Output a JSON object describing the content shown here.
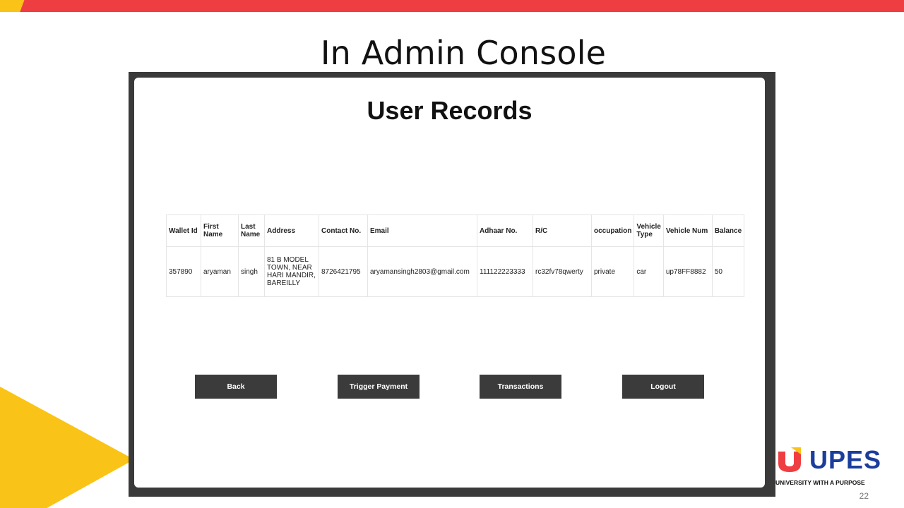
{
  "slide": {
    "title": "In Admin Console",
    "page_number": "22",
    "brand": {
      "name": "UPES",
      "tagline": "UNIVERSITY WITH A PURPOSE"
    }
  },
  "colors": {
    "accent_red": "#ef3e42",
    "accent_yellow": "#f9c417",
    "brand_blue": "#1b3d9c",
    "button": "#3b3b3b"
  },
  "app": {
    "heading": "User Records",
    "table": {
      "headers": [
        "Wallet Id",
        "First Name",
        "Last Name",
        "Address",
        "Contact No.",
        "Email",
        "Adhaar No.",
        "R/C",
        "occupation",
        "Vehicle Type",
        "Vehicle Num",
        "Balance"
      ],
      "rows": [
        {
          "wallet_id": "357890",
          "first_name": "aryaman",
          "last_name": "singh",
          "address": "81 B MODEL TOWN, NEAR HARI MANDIR, BAREILLY",
          "contact": "8726421795",
          "email": "aryamansingh2803@gmail.com",
          "adhaar": "111122223333",
          "rc": "rc32fv78qwerty",
          "occupation": "private",
          "vehicle_type": "car",
          "vehicle_num": "up78FF8882",
          "balance": "50"
        }
      ]
    },
    "buttons": {
      "back": "Back",
      "trigger_payment": "Trigger Payment",
      "transactions": "Transactions",
      "logout": "Logout"
    }
  }
}
